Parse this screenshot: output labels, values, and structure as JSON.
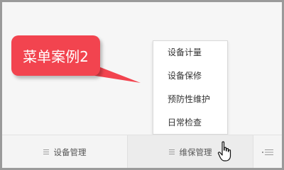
{
  "callout": {
    "text": "菜单案例2",
    "color": "#f2444f"
  },
  "dropdown": {
    "items": [
      {
        "label": "设备计量"
      },
      {
        "label": "设备保修"
      },
      {
        "label": "预防性维护"
      },
      {
        "label": "日常检查"
      }
    ]
  },
  "bottom_nav": {
    "items": [
      {
        "label": "设备管理",
        "icon": "menu-icon"
      },
      {
        "label": "维保管理",
        "icon": "menu-icon",
        "active": true
      },
      {
        "label": "",
        "icon": "list-icon"
      }
    ]
  },
  "cursor": {
    "icon": "hand-pointer-icon"
  }
}
